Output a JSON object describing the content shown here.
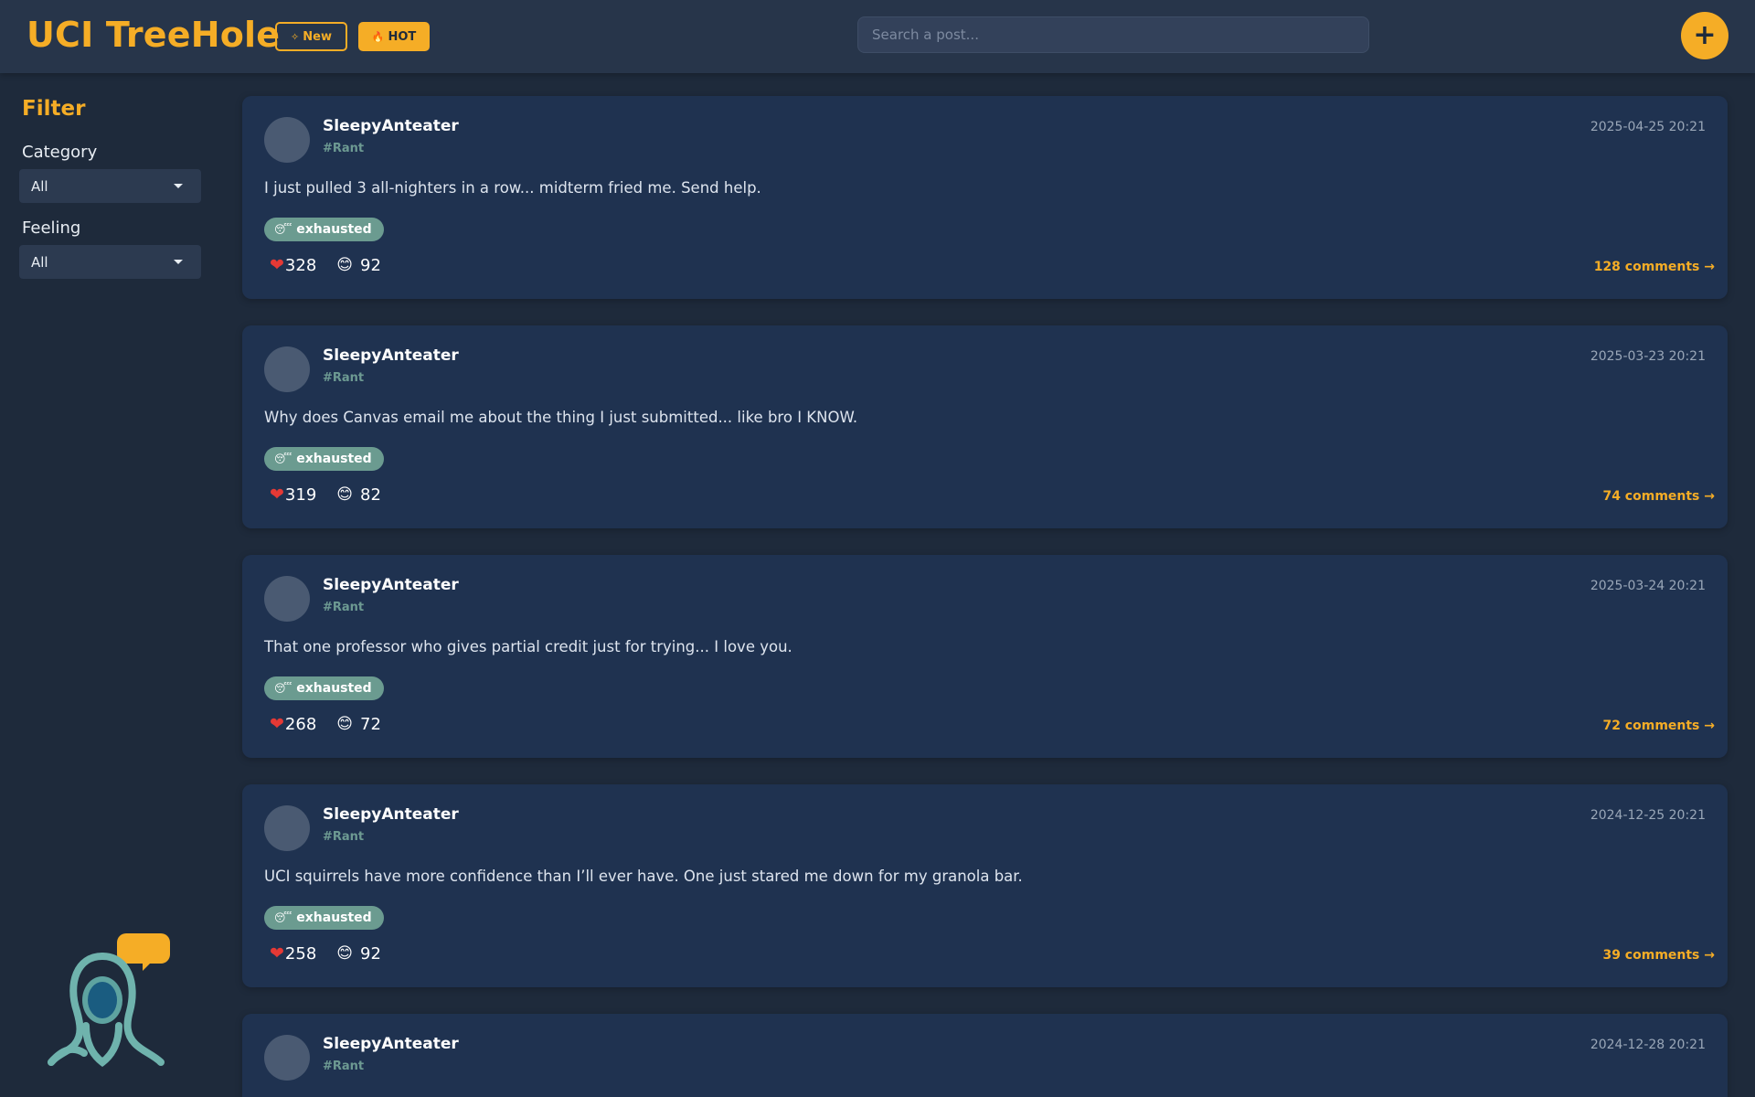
{
  "header": {
    "brand": "UCI TreeHole",
    "new_label": "New",
    "new_icon": "sparkle-icon",
    "hot_label": "HOT",
    "hot_icon": "fire-icon",
    "search_placeholder": "Search a post...",
    "add_label": "+"
  },
  "sidebar": {
    "title": "Filter",
    "category_label": "Category",
    "category_value": "All",
    "feeling_label": "Feeling",
    "feeling_value": "All"
  },
  "colors": {
    "accent": "#f5ad26",
    "background": "#1e2a3b",
    "card": "#1f3250",
    "tag": "#6b9b90"
  },
  "posts": [
    {
      "author": "SleepyAnteater",
      "category": "#Rant",
      "time": "2025-04-25 20:21",
      "content": "I just pulled 3 all-nighters in a row... midterm fried me. Send help.",
      "tag": "exhausted",
      "likes": "328",
      "smiles": "92",
      "comments": "128 comments →"
    },
    {
      "author": "SleepyAnteater",
      "category": "#Rant",
      "time": "2025-03-23 20:21",
      "content": "Why does Canvas email me about the thing I just submitted... like bro I KNOW.",
      "tag": "exhausted",
      "likes": "319",
      "smiles": "82",
      "comments": "74 comments →"
    },
    {
      "author": "SleepyAnteater",
      "category": "#Rant",
      "time": "2025-03-24 20:21",
      "content": "That one professor who gives partial credit just for trying... I love you.",
      "tag": "exhausted",
      "likes": "268",
      "smiles": "72",
      "comments": "72 comments →"
    },
    {
      "author": "SleepyAnteater",
      "category": "#Rant",
      "time": "2024-12-25 20:21",
      "content": "UCI squirrels have more confidence than I’ll ever have. One just stared me down for my granola bar.",
      "tag": "exhausted",
      "likes": "258",
      "smiles": "92",
      "comments": "39 comments →"
    },
    {
      "author": "SleepyAnteater",
      "category": "#Rant",
      "time": "2024-12-28 20:21"
    }
  ]
}
